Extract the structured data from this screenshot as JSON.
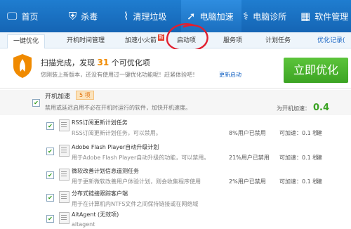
{
  "nav": [
    {
      "label": "首页",
      "icon": "monitor-icon"
    },
    {
      "label": "杀毒",
      "icon": "shield-icon"
    },
    {
      "label": "清理垃圾",
      "icon": "broom-icon"
    },
    {
      "label": "电脑加速",
      "icon": "rocket-icon"
    },
    {
      "label": "电脑诊所",
      "icon": "stethoscope-icon"
    },
    {
      "label": "软件管理",
      "icon": "grid-icon"
    }
  ],
  "subtabs": [
    "一键优化",
    "开机时间管理",
    "加速小火箭",
    "启动项",
    "服务项",
    "计划任务"
  ],
  "subtab_hot": "新",
  "history_link": "优化记录(",
  "scan": {
    "title_prefix": "扫描完成，发现 ",
    "count": "31",
    "title_suffix": " 个可优化项",
    "subtitle": "您刚装上新版本，还没有使用过一键优化功能呢！赶紧体验吧！",
    "more_link": "更新启动"
  },
  "optimize_button": "立即优化",
  "group": {
    "title": "开机加速",
    "badge": "5 项",
    "description": "禁用或延迟启用不必在开机时运行的软件，加快开机速度。",
    "speed_label": "为开机加速：",
    "speed_value": "0.4"
  },
  "items": [
    {
      "title": "RSS订阅更新计划任务",
      "desc": "RSS订阅更新计划任务，可以禁用。",
      "pct": "8%用户已禁用",
      "action": "可加速：0.1 秒",
      "dd": "建"
    },
    {
      "title": "Adobe Flash Player自动升级计划",
      "desc": "用于Adobe Flash Player自动升级的功能，可以禁用。",
      "pct": "21%用户已禁用",
      "action": "可加速：0.1 秒",
      "dd": "建"
    },
    {
      "title": "微软改善计划信息遥测任务",
      "desc": "用于更新微软改善用户体验计划，则会收集程序使用",
      "pct": "2%用户已禁用",
      "action": "可加速：0.1 秒",
      "dd": "建"
    },
    {
      "title": "分布式链接跟踪客户端",
      "desc": "用于在计算机内NTFS文件之间保持链接或在网络域",
      "pct": "",
      "action": "",
      "dd": ""
    },
    {
      "title": "AitAgent (无效项)",
      "desc": "aitagent",
      "pct": "",
      "action": "",
      "dd": ""
    }
  ],
  "colors": {
    "topbar": "#1a6fc4",
    "accent_green": "#4cb52c",
    "badge_orange": "#f08a00",
    "annotation_red": "#e21f2f"
  }
}
